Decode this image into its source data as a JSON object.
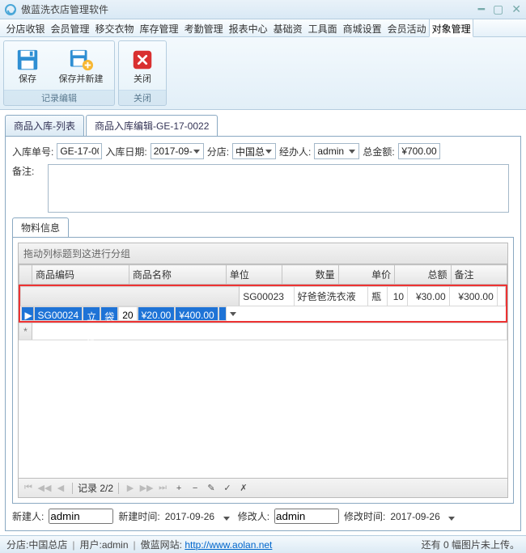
{
  "window": {
    "title": "傲蓝洗衣店管理软件"
  },
  "menu": {
    "items": [
      "分店收银",
      "会员管理",
      "移交衣物",
      "库存管理",
      "考勤管理",
      "报表中心",
      "基础资",
      "工具面",
      "商城设置",
      "会员活动",
      "对象管理"
    ],
    "active_index": 10
  },
  "ribbon": {
    "group1_label": "记录编辑",
    "save_label": "保存",
    "save_new_label": "保存并新建",
    "group2_label": "关闭",
    "close_label": "关闭"
  },
  "tabs": {
    "t0": "商品入库-列表",
    "t1": "商品入库编辑-GE-17-0022",
    "active": 1
  },
  "form": {
    "order_no_label": "入库单号:",
    "order_no": "GE-17-00",
    "date_label": "入库日期:",
    "date": "2017-09-",
    "branch_label": "分店:",
    "branch": "中国总",
    "handler_label": "经办人:",
    "handler": "admin",
    "total_label": "总金额:",
    "total": "¥700.00",
    "remark_label": "备注:"
  },
  "subtab": {
    "materials": "物料信息"
  },
  "grid": {
    "group_hint": "拖动列标题到这进行分组",
    "cols": [
      "商品编码",
      "商品名称",
      "单位",
      "数量",
      "单价",
      "总额",
      "备注"
    ],
    "rows": [
      {
        "code": "SG00023",
        "name": "好爸爸洗衣液",
        "unit": "瓶",
        "qty": "10",
        "price": "¥30.00",
        "amount": "¥300.00",
        "remark": ""
      },
      {
        "code": "SG00024",
        "name": "立白洗衣皂粉",
        "unit": "袋",
        "qty": "20",
        "price": "¥20.00",
        "amount": "¥400.00",
        "remark": ""
      }
    ],
    "selected_row": 1,
    "nav_label": "记录 2/2"
  },
  "audit": {
    "creator_label": "新建人:",
    "creator": "admin",
    "ctime_label": "新建时间:",
    "ctime": "2017-09-26",
    "modifier_label": "修改人:",
    "modifier": "admin",
    "mtime_label": "修改时间:",
    "mtime": "2017-09-26"
  },
  "status": {
    "branch_label": "分店:",
    "branch": "中国总店",
    "user_label": "用户:",
    "user": "admin",
    "site_label": "傲蓝网站:",
    "site_url": "http://www.aolan.net",
    "tail": "还有 0 幅图片未上传。"
  }
}
